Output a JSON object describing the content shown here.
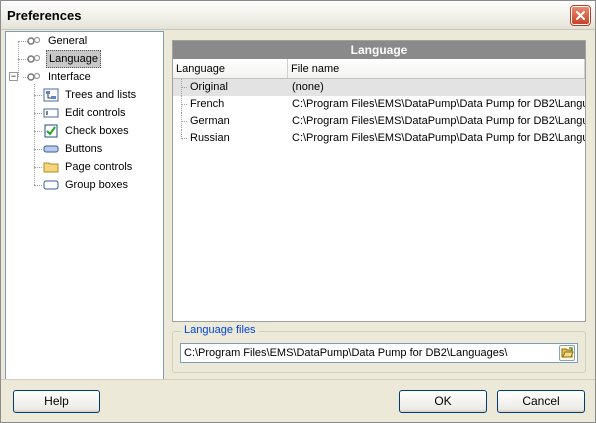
{
  "window": {
    "title": "Preferences"
  },
  "tree": {
    "items": [
      {
        "label": "General",
        "icon": "settings-icon",
        "selected": false
      },
      {
        "label": "Language",
        "icon": "settings-icon",
        "selected": true
      },
      {
        "label": "Interface",
        "icon": "settings-icon",
        "selected": false,
        "expanded": true
      },
      {
        "label": "Trees and lists",
        "icon": "tree-icon",
        "selected": false
      },
      {
        "label": "Edit controls",
        "icon": "edit-control-icon",
        "selected": false
      },
      {
        "label": "Check boxes",
        "icon": "checkbox-icon",
        "selected": false
      },
      {
        "label": "Buttons",
        "icon": "button-icon",
        "selected": false
      },
      {
        "label": "Page controls",
        "icon": "folder-icon",
        "selected": false
      },
      {
        "label": "Group boxes",
        "icon": "group-box-icon",
        "selected": false
      }
    ]
  },
  "content": {
    "header": "Language",
    "columns": [
      "Language",
      "File name"
    ],
    "rows": [
      {
        "language": "Original",
        "file": "(none)"
      },
      {
        "language": "French",
        "file": "C:\\Program Files\\EMS\\DataPump\\Data Pump for DB2\\Langu"
      },
      {
        "language": "German",
        "file": "C:\\Program Files\\EMS\\DataPump\\Data Pump for DB2\\Langu"
      },
      {
        "language": "Russian",
        "file": "C:\\Program Files\\EMS\\DataPump\\Data Pump for DB2\\Langu"
      }
    ]
  },
  "language_files": {
    "legend": "Language files",
    "path": "C:\\Program Files\\EMS\\DataPump\\Data Pump for DB2\\Languages\\"
  },
  "buttons": {
    "help": "Help",
    "ok": "OK",
    "cancel": "Cancel"
  },
  "colors": {
    "content_header_bg": "#8a8a8a",
    "legend_text": "#0046d5",
    "close_button": "#c8432a"
  }
}
